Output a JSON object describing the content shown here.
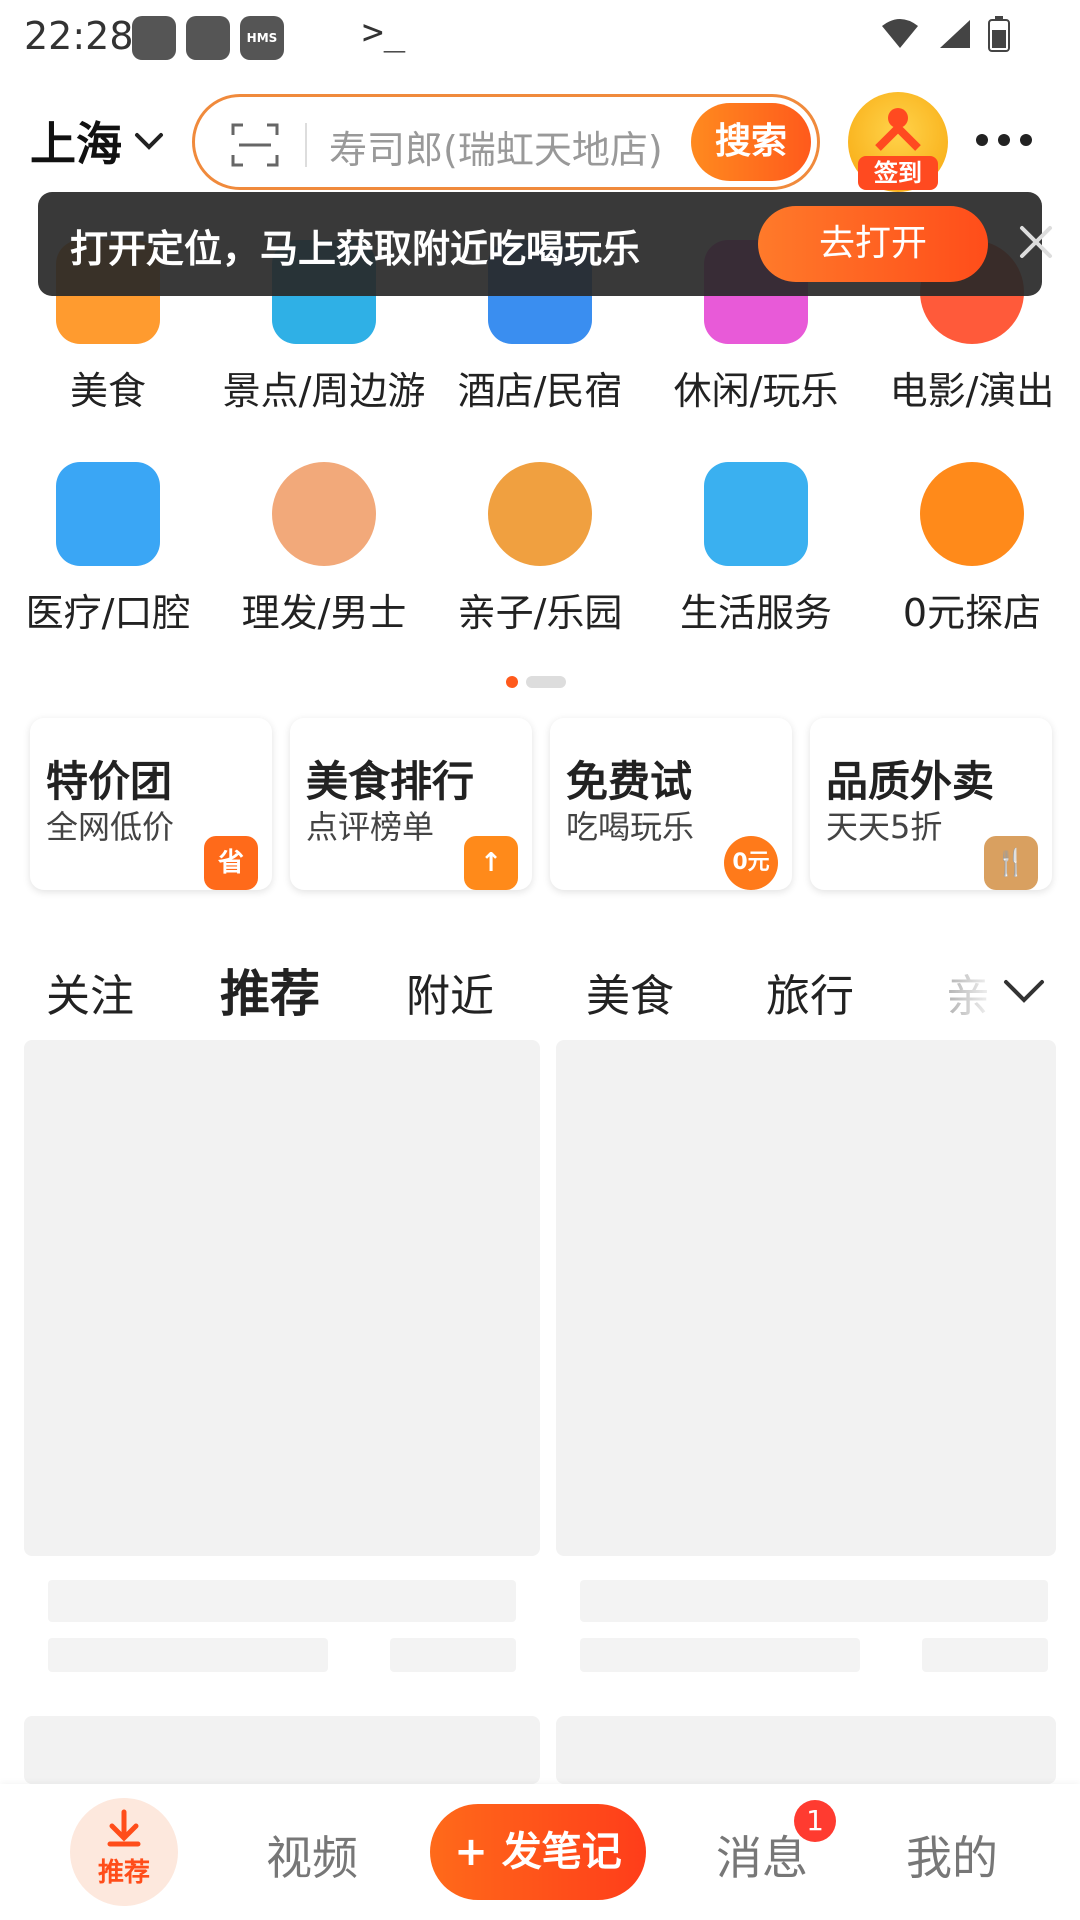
{
  "status_bar": {
    "time": "22:28",
    "hms_label": "HMS",
    "terminal_label": ">_"
  },
  "header": {
    "city": "上海",
    "search_placeholder": "寿司郎(瑞虹天地店)",
    "search_button": "搜索",
    "signin_label": "签到"
  },
  "toast": {
    "message": "打开定位，马上获取附近吃喝玩乐",
    "action": "去打开"
  },
  "categories": [
    {
      "label": "美食",
      "icon": "food-icon",
      "color": "#ff9b2f"
    },
    {
      "label": "景点/周边游",
      "icon": "travel-icon",
      "color": "#2fb0e6"
    },
    {
      "label": "酒店/民宿",
      "icon": "hotel-icon",
      "color": "#3a8ef0"
    },
    {
      "label": "休闲/玩乐",
      "icon": "leisure-icon",
      "color": "#e85ad8"
    },
    {
      "label": "电影/演出",
      "icon": "movie-icon",
      "color": "#ff5a3a"
    },
    {
      "label": "医疗/口腔",
      "icon": "medical-icon",
      "color": "#3aa6f5"
    },
    {
      "label": "理发/男士",
      "icon": "barber-icon",
      "color": "#f2a97a"
    },
    {
      "label": "亲子/乐园",
      "icon": "parenting-icon",
      "color": "#f0a040"
    },
    {
      "label": "生活服务",
      "icon": "life-service-icon",
      "color": "#3ab0f0"
    },
    {
      "label": "0元探店",
      "icon": "explore-icon",
      "color": "#ff8a1a"
    }
  ],
  "promos": [
    {
      "title": "特价团",
      "subtitle": "全网低价",
      "badge": "省",
      "badge_color": "#ff6a1a"
    },
    {
      "title": "美食排行",
      "subtitle": "点评榜单",
      "badge": "↑",
      "badge_color": "#ff8a1a"
    },
    {
      "title": "免费试",
      "subtitle": "吃喝玩乐",
      "badge": "0元",
      "badge_color": "#ff7a1a"
    },
    {
      "title": "品质外卖",
      "subtitle": "天天5折",
      "badge": "🍴",
      "badge_color": "#d9a060"
    }
  ],
  "feed_tabs": [
    "关注",
    "推荐",
    "附近",
    "美食",
    "旅行",
    "亲"
  ],
  "active_tab": "推荐",
  "bottom_nav": {
    "home": "推荐",
    "video": "视频",
    "post": "+ 发笔记",
    "messages": "消息",
    "messages_badge": "1",
    "profile": "我的"
  },
  "colors": {
    "accent": "#ff5a1c",
    "accent_light": "#ff8a1f"
  }
}
